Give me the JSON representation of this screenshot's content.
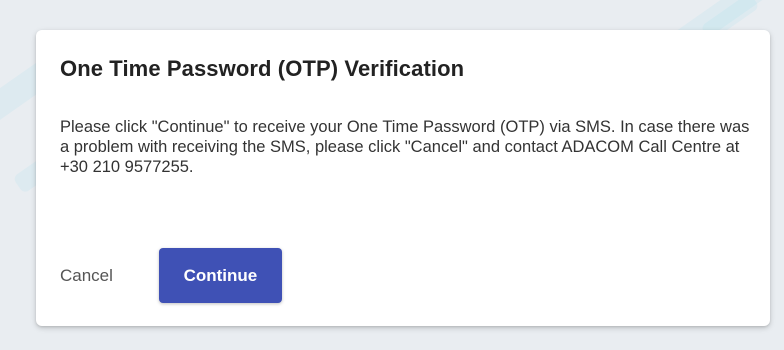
{
  "dialog": {
    "title": "One Time Password (OTP) Verification",
    "message": "Please click \"Continue\" to receive your One Time Password (OTP) via SMS. In case there was a problem with receiving the SMS, please click \"Cancel\" and contact ADACOM Call Centre at +30 210 9577255.",
    "cancel_label": "Cancel",
    "continue_label": "Continue"
  },
  "colors": {
    "background": "#e9edf1",
    "dialog_background": "#ffffff",
    "primary_button": "#3f51b5",
    "title_text": "#222222",
    "body_text": "#333333"
  }
}
